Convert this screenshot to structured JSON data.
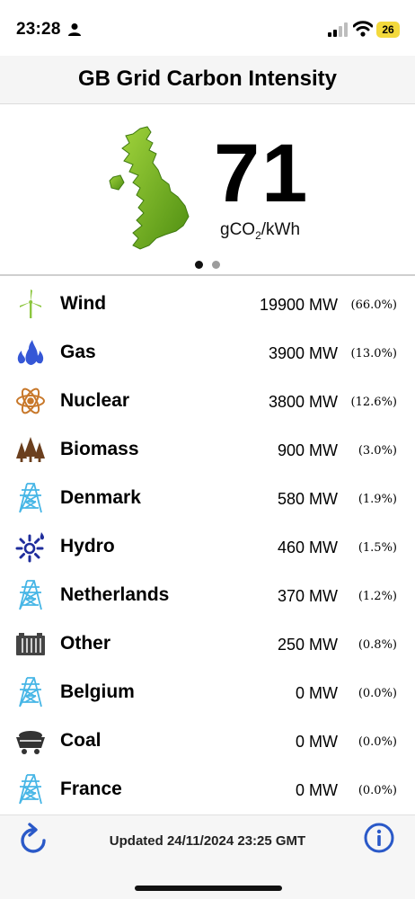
{
  "status_bar": {
    "time": "23:28",
    "battery": "26",
    "icons": [
      "person-icon",
      "signal-icon",
      "wifi-icon",
      "battery-icon"
    ]
  },
  "header": {
    "title": "GB Grid Carbon Intensity"
  },
  "hero": {
    "value": "71",
    "unit_prefix": "gCO",
    "unit_sub": "2",
    "unit_suffix": "/kWh",
    "page_count": 2,
    "active_page": 1
  },
  "sources": [
    {
      "name": "Wind",
      "mw": "19900 MW",
      "pct": "(66.0%)",
      "icon": "wind-turbine-icon",
      "color": "#8cc63f"
    },
    {
      "name": "Gas",
      "mw": "3900 MW",
      "pct": "(13.0%)",
      "icon": "gas-flame-icon",
      "color": "#3557d6"
    },
    {
      "name": "Nuclear",
      "mw": "3800 MW",
      "pct": "(12.6%)",
      "icon": "atom-icon",
      "color": "#c8782a"
    },
    {
      "name": "Biomass",
      "mw": "900 MW",
      "pct": "(3.0%)",
      "icon": "trees-icon",
      "color": "#6b3f1e"
    },
    {
      "name": "Denmark",
      "mw": "580 MW",
      "pct": "(1.9%)",
      "icon": "pylon-icon",
      "color": "#47b6e6"
    },
    {
      "name": "Hydro",
      "mw": "460 MW",
      "pct": "(1.5%)",
      "icon": "hydro-turbine-icon",
      "color": "#1f2d9c"
    },
    {
      "name": "Netherlands",
      "mw": "370 MW",
      "pct": "(1.2%)",
      "icon": "pylon-icon",
      "color": "#47b6e6"
    },
    {
      "name": "Other",
      "mw": "250 MW",
      "pct": "(0.8%)",
      "icon": "battery-bank-icon",
      "color": "#444444"
    },
    {
      "name": "Belgium",
      "mw": "0 MW",
      "pct": "(0.0%)",
      "icon": "pylon-icon",
      "color": "#47b6e6"
    },
    {
      "name": "Coal",
      "mw": "0 MW",
      "pct": "(0.0%)",
      "icon": "coal-cart-icon",
      "color": "#333333"
    },
    {
      "name": "France",
      "mw": "0 MW",
      "pct": "(0.0%)",
      "icon": "pylon-icon",
      "color": "#47b6e6"
    }
  ],
  "footer": {
    "updated": "Updated 24/11/2024 23:25 GMT",
    "refresh_icon": "refresh-icon",
    "info_icon": "info-icon",
    "accent": "#2a59c8"
  }
}
